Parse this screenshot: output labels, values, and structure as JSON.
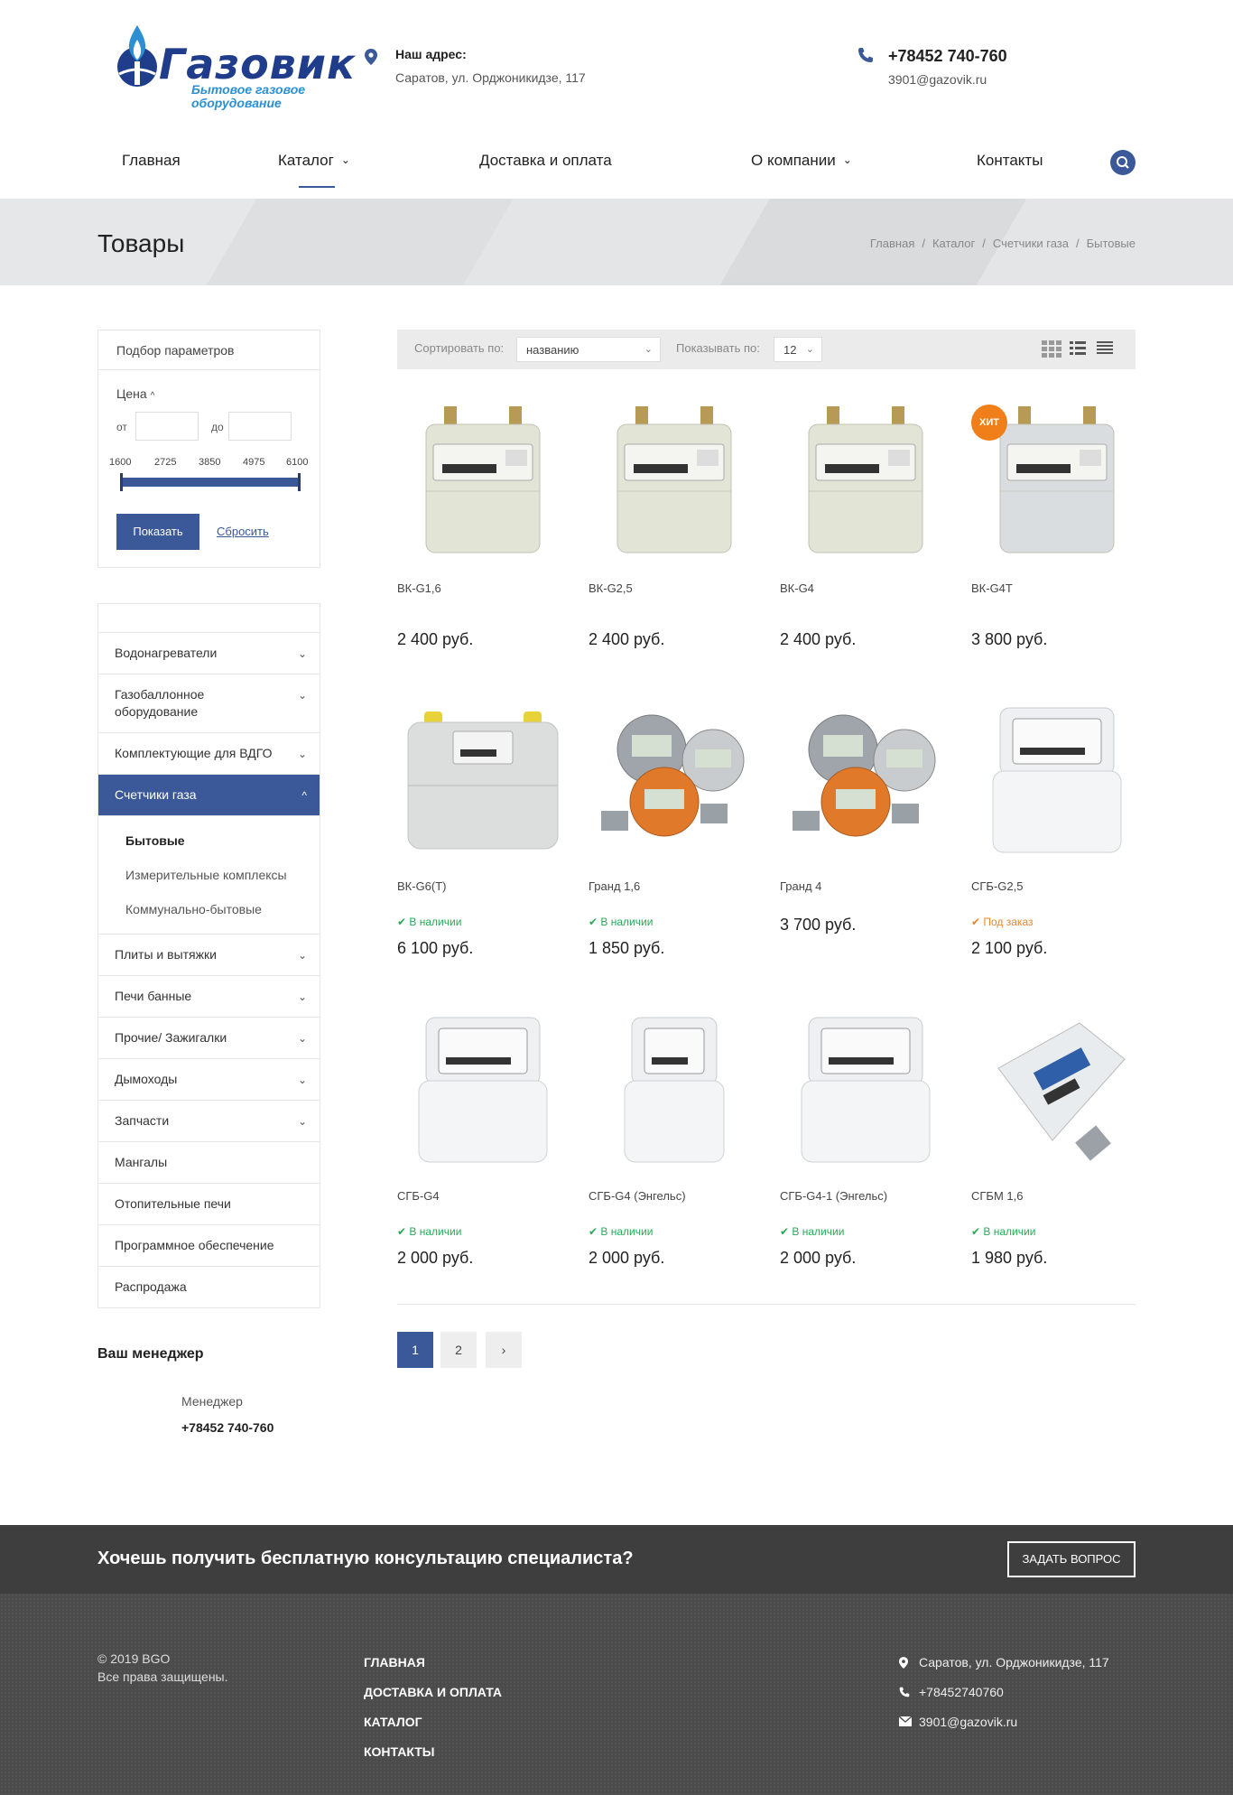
{
  "header": {
    "logo_word": "Газовик",
    "logo_sub_1": "Бытовое газовое",
    "logo_sub_2": "оборудование",
    "address_title": "Наш адрес:",
    "address": "Саратов, ул. Орджоникидзе, 117",
    "phone": "+78452 740-760",
    "email": "3901@gazovik.ru"
  },
  "nav": {
    "items": [
      "Главная",
      "Каталог",
      "Доставка и оплата",
      "О компании",
      "Контакты"
    ]
  },
  "title_band": {
    "title": "Товары",
    "breadcrumbs": [
      "Главная",
      "Каталог",
      "Счетчики газа",
      "Бытовые"
    ]
  },
  "filter": {
    "title": "Подбор параметров",
    "price_label": "Цена",
    "from_label": "от",
    "to_label": "до",
    "ticks": [
      "1600",
      "2725",
      "3850",
      "4975",
      "6100"
    ],
    "price_min": 1600,
    "price_max": 6100,
    "show_button": "Показать",
    "reset_link": "Сбросить"
  },
  "categories": {
    "top_fragment": "",
    "items": [
      {
        "label": "Водонагреватели",
        "expandable": true
      },
      {
        "label": "Газобаллонное оборудование",
        "expandable": true
      },
      {
        "label": "Комплектующие для ВДГО",
        "expandable": true
      },
      {
        "label": "Счетчики газа",
        "expandable": true,
        "active": true
      },
      {
        "label": "Плиты и вытяжки",
        "expandable": true
      },
      {
        "label": "Печи банные",
        "expandable": true
      },
      {
        "label": "Прочие/ Зажигалки",
        "expandable": true
      },
      {
        "label": "Дымоходы",
        "expandable": true
      },
      {
        "label": "Запчасти",
        "expandable": true
      },
      {
        "label": "Мангалы",
        "expandable": false
      },
      {
        "label": "Отопительные печи",
        "expandable": false
      },
      {
        "label": "Программное обеспечение",
        "expandable": false
      },
      {
        "label": "Распродажа",
        "expandable": false
      }
    ],
    "subcategories": [
      "Бытовые",
      "Измерительные комплексы",
      "Коммунально-бытовые"
    ]
  },
  "manager": {
    "title": "Ваш менеджер",
    "role": "Менеджер",
    "phone": "+78452 740-760"
  },
  "toolbar": {
    "sort_label": "Сортировать по:",
    "sort_value": "названию",
    "show_label": "Показывать по:",
    "show_value": "12"
  },
  "products": [
    {
      "name": "ВК-G1,6",
      "status": "",
      "status_type": "",
      "price": "2 400 руб.",
      "image": "gas-meter-bk",
      "hit": false
    },
    {
      "name": "ВК-G2,5",
      "status": "",
      "status_type": "",
      "price": "2 400 руб.",
      "image": "gas-meter-bk",
      "hit": false
    },
    {
      "name": "ВК-G4",
      "status": "",
      "status_type": "",
      "price": "2 400 руб.",
      "image": "gas-meter-bk",
      "hit": false
    },
    {
      "name": "ВК-G4Т",
      "status": "",
      "status_type": "",
      "price": "3 800 руб.",
      "image": "gas-meter-bk-t",
      "hit": true
    },
    {
      "name": "ВК-G6(Т)",
      "status": "В наличии",
      "status_type": "ok",
      "price": "6 100 руб.",
      "image": "gas-meter-bk-wide",
      "hit": false
    },
    {
      "name": "Гранд 1,6",
      "status": "В наличии",
      "status_type": "ok",
      "price": "1 850 руб.",
      "image": "gas-meter-grand",
      "hit": false
    },
    {
      "name": "Гранд 4",
      "status": "",
      "status_type": "",
      "price": "3 700 руб.",
      "image": "gas-meter-grand",
      "hit": false
    },
    {
      "name": "СГБ-G2,5",
      "status": "Под заказ",
      "status_type": "order",
      "price": "2 100 руб.",
      "image": "gas-meter-sgb",
      "hit": false
    },
    {
      "name": "СГБ-G4",
      "status": "В наличии",
      "status_type": "ok",
      "price": "2 000 руб.",
      "image": "gas-meter-sgb",
      "hit": false
    },
    {
      "name": "СГБ-G4 (Энгельс)",
      "status": "В наличии",
      "status_type": "ok",
      "price": "2 000 руб.",
      "image": "gas-meter-sgb-small",
      "hit": false
    },
    {
      "name": "СГБ-G4-1 (Энгельс)",
      "status": "В наличии",
      "status_type": "ok",
      "price": "2 000 руб.",
      "image": "gas-meter-sgb",
      "hit": false
    },
    {
      "name": "СГБМ 1,6",
      "status": "В наличии",
      "status_type": "ok",
      "price": "1 980 руб.",
      "image": "gas-meter-sgbm",
      "hit": false
    }
  ],
  "hit_badge": "ХИТ",
  "pagination": {
    "pages": [
      "1",
      "2"
    ],
    "current": "1",
    "next": "›"
  },
  "cta": {
    "text": "Хочешь получить бесплатную консультацию специалиста?",
    "button": "ЗАДАТЬ ВОПРОС"
  },
  "footer": {
    "copyright": "© 2019 BGO",
    "rights": "Все права защищены.",
    "links": [
      "ГЛАВНАЯ",
      "ДОСТАВКА И ОПЛАТА",
      "КАТАЛОГ",
      "КОНТАКТЫ"
    ],
    "address": "Саратов, ул. Орджоникидзе, 117",
    "phone": "+78452740760",
    "email": "3901@gazovik.ru"
  },
  "colors": {
    "accent": "#3b5998",
    "in_stock": "#2aa857",
    "on_order": "#e8862a",
    "hit": "#f07f1a",
    "cta_bg": "#3e3e3e",
    "footer_bg": "#4b4b4b"
  }
}
